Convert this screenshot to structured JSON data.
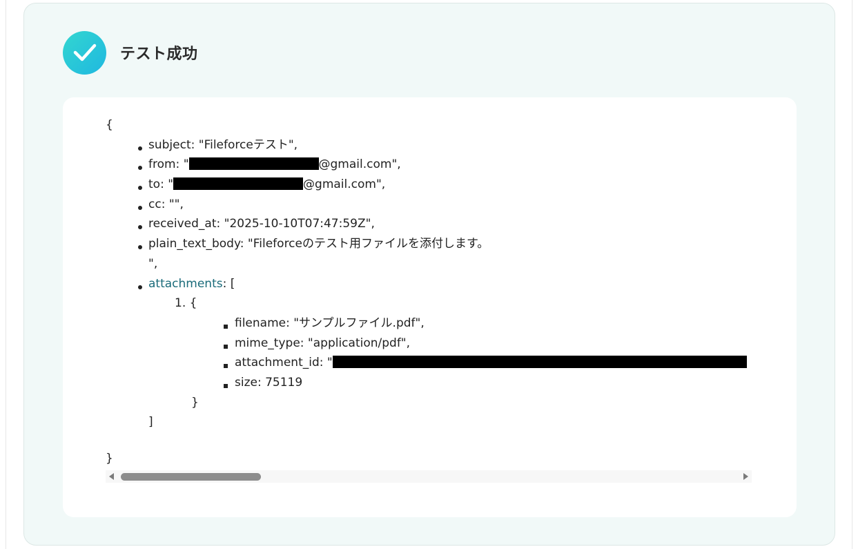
{
  "status": {
    "title": "テスト成功",
    "icon": "check-icon",
    "accent_color": "#22c7dc"
  },
  "output": {
    "open_brace": "{",
    "close_brace": "}",
    "fields": {
      "subject": "subject: \"Fileforceテスト\",",
      "from_prefix": "from: \"",
      "from_suffix": "@gmail.com\",",
      "to_prefix": "to: \"",
      "to_suffix": "@gmail.com\",",
      "cc": "cc: \"\",",
      "received_at": "received_at: \"2025-10-10T07:47:59Z\",",
      "plain_text_body_line1": "plain_text_body: \"Fileforceのテスト用ファイルを添付します。",
      "plain_text_body_line2": "\",",
      "attachments_key": "attachments",
      "attachments_open": ": [",
      "attachments_close": "]"
    },
    "attachments": [
      {
        "index_open": "1. {",
        "filename": "filename: \"サンプルファイル.pdf\",",
        "mime_type": "mime_type: \"application/pdf\",",
        "attachment_id_prefix": "attachment_id: \"",
        "size": "size: 75119",
        "close": "}"
      }
    ]
  }
}
